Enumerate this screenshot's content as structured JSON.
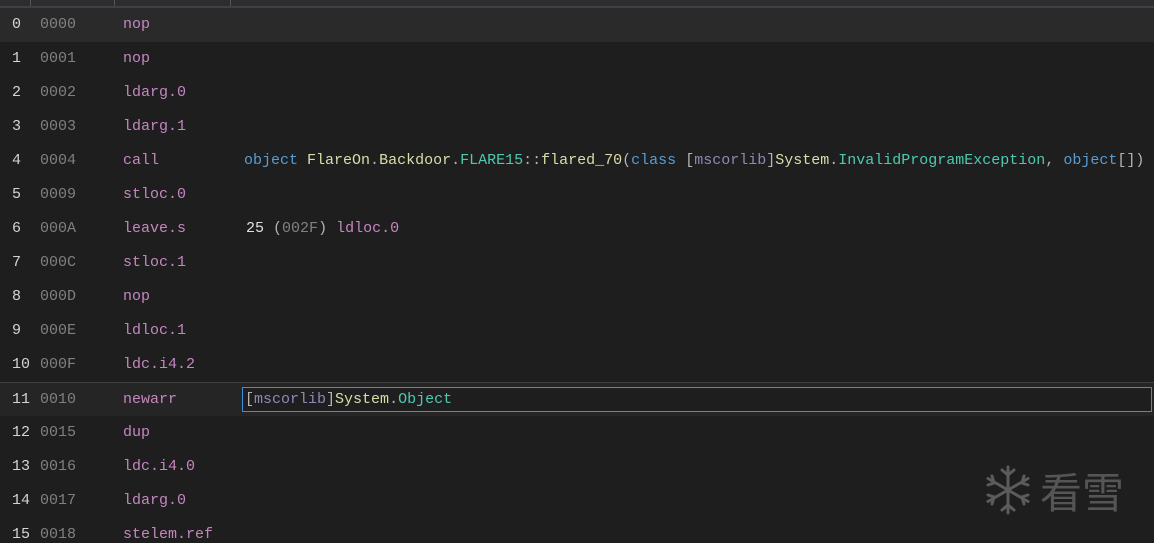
{
  "rows": [
    {
      "index": "0",
      "offset": "0000",
      "opcode": "nop"
    },
    {
      "index": "1",
      "offset": "0001",
      "opcode": "nop"
    },
    {
      "index": "2",
      "offset": "0002",
      "opcode": "ldarg.0"
    },
    {
      "index": "3",
      "offset": "0003",
      "opcode": "ldarg.1"
    },
    {
      "index": "4",
      "offset": "0004",
      "opcode": "call"
    },
    {
      "index": "5",
      "offset": "0009",
      "opcode": "stloc.0"
    },
    {
      "index": "6",
      "offset": "000A",
      "opcode": "leave.s"
    },
    {
      "index": "7",
      "offset": "000C",
      "opcode": "stloc.1"
    },
    {
      "index": "8",
      "offset": "000D",
      "opcode": "nop"
    },
    {
      "index": "9",
      "offset": "000E",
      "opcode": "ldloc.1"
    },
    {
      "index": "10",
      "offset": "000F",
      "opcode": "ldc.i4.2"
    },
    {
      "index": "11",
      "offset": "0010",
      "opcode": "newarr"
    },
    {
      "index": "12",
      "offset": "0015",
      "opcode": "dup"
    },
    {
      "index": "13",
      "offset": "0016",
      "opcode": "ldc.i4.0"
    },
    {
      "index": "14",
      "offset": "0017",
      "opcode": "ldarg.0"
    },
    {
      "index": "15",
      "offset": "0018",
      "opcode": "stelem.ref"
    }
  ],
  "operands": {
    "call": {
      "ret": "object",
      "ns1": "FlareOn",
      "dot1": ".",
      "ns2": "Backdoor",
      "dot2": ".",
      "cls": "FLARE15",
      "sep": "::",
      "method": "flared_70",
      "open": "(",
      "kw_class": "class",
      "lb": "[",
      "asm": "mscorlib",
      "rb": "]",
      "sys": "System",
      "dot3": ".",
      "exc": "InvalidProgramException",
      "comma": ",",
      "objarr": "object",
      "brackets": "[]",
      "close": ")"
    },
    "leave": {
      "num": "25",
      "lp": "(",
      "hex": "002F",
      "rp": ")",
      "target": "ldloc.0"
    },
    "newarr": {
      "lb": "[",
      "asm": "mscorlib",
      "rb": "]",
      "sys": "System",
      "dot": ".",
      "obj": "Object"
    }
  },
  "watermark": {
    "icon": "snowflake-icon",
    "text": "看雪"
  },
  "colors": {
    "background": "#1e1e1e",
    "opcode": "#c586c0",
    "offset": "#808080",
    "selection_border": "#3d8fd6"
  }
}
